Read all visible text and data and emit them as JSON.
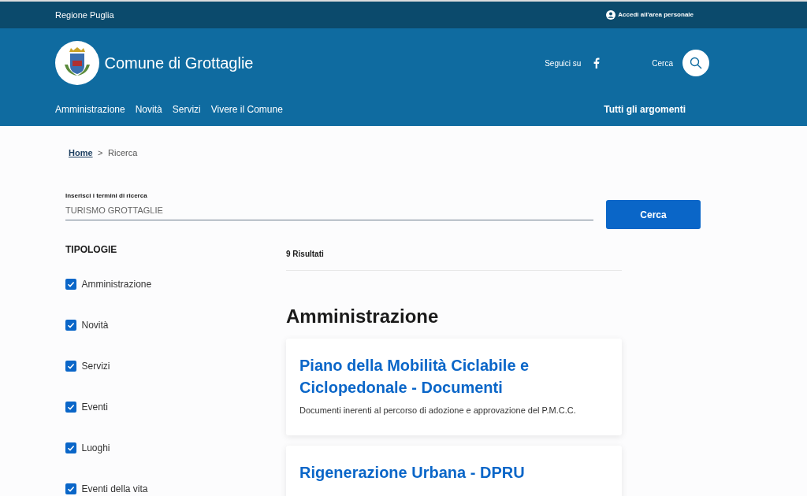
{
  "top_bar": {
    "region": "Regione Puglia",
    "login": "Accedi all'area personale"
  },
  "header": {
    "title": "Comune di Grottaglie",
    "social_label": "Seguici su",
    "search_label": "Cerca"
  },
  "nav": {
    "items": [
      "Amministrazione",
      "Novità",
      "Servizi",
      "Vivere il Comune"
    ],
    "topics": "Tutti gli argomenti"
  },
  "breadcrumb": [
    "Home",
    ">",
    "Ricerca"
  ],
  "search": {
    "label": "Inserisci i termini di ricerca",
    "value": "TURISMO GROTTAGLIE",
    "button": "Cerca"
  },
  "filters": {
    "title": "TIPOLOGIE",
    "items": [
      {
        "label": "Amministrazione",
        "checked": true
      },
      {
        "label": "Novità",
        "checked": true
      },
      {
        "label": "Servizi",
        "checked": true
      },
      {
        "label": "Eventi",
        "checked": true
      },
      {
        "label": "Luoghi",
        "checked": true
      },
      {
        "label": "Eventi della vita",
        "checked": true
      }
    ]
  },
  "results": {
    "count": "9 Risultati",
    "section": "Amministrazione",
    "items": [
      {
        "title": "Piano della Mobilità Ciclabile e Ciclopedonale - Documenti",
        "description": "Documenti inerenti al percorso di adozione e approvazione del P.M.C.C."
      },
      {
        "title": "Rigenerazione Urbana - DPRU"
      }
    ]
  }
}
